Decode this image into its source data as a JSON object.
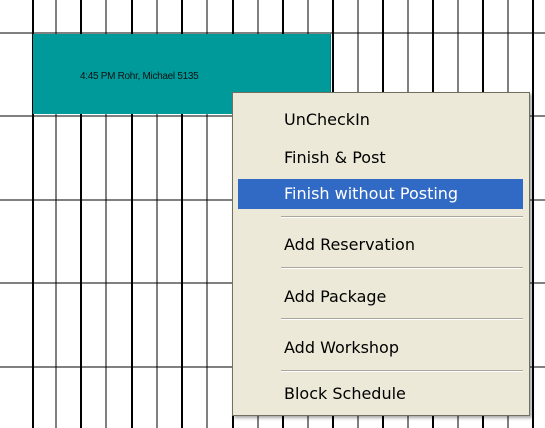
{
  "appointment": {
    "text": "4:45 PM Rohr, Michael 5135",
    "color": "#009a9a"
  },
  "context_menu": {
    "items": [
      {
        "label": "UnCheckIn"
      },
      {
        "label": "Finish & Post"
      },
      {
        "label": "Finish without Posting",
        "highlighted": true
      },
      {
        "label": "Add Reservation"
      },
      {
        "label": "Add Package"
      },
      {
        "label": "Add Workshop"
      },
      {
        "label": "Block Schedule"
      }
    ],
    "highlight_color": "#316ac5",
    "background_color": "#ece9d8"
  }
}
